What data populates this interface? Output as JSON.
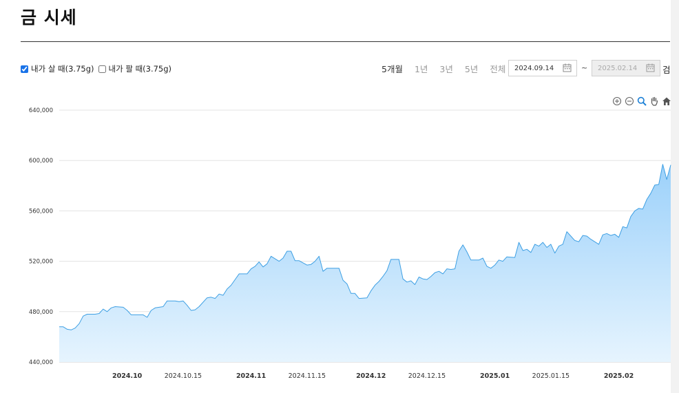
{
  "page": {
    "title": "금 시세"
  },
  "options": [
    {
      "label": "내가 살 때(3.75g)",
      "checked": true
    },
    {
      "label": "내가 팔 때(3.75g)",
      "checked": false
    }
  ],
  "periods": [
    {
      "label": "5개월",
      "active": true
    },
    {
      "label": "1년",
      "active": false
    },
    {
      "label": "3년",
      "active": false
    },
    {
      "label": "5년",
      "active": false
    },
    {
      "label": "전체",
      "active": false
    }
  ],
  "date_range": {
    "start": "2024.09.14",
    "separator": "~",
    "end": "2025.02.14",
    "search_label": "검"
  },
  "toolbar_icons": [
    "zoom-in-icon",
    "zoom-out-icon",
    "magnify-icon",
    "pan-hand-icon",
    "home-icon"
  ],
  "colors": {
    "line": "#3d9fe3",
    "fill_top": "#9cd1fa",
    "fill_bottom": "#e6f4fe",
    "grid": "#e3e3e3",
    "checkbox_accent": "#1a73e8"
  },
  "chart_data": {
    "type": "area",
    "title": "",
    "xlabel": "",
    "ylabel": "",
    "ylim": [
      440000,
      640000
    ],
    "yticks": [
      440000,
      480000,
      520000,
      560000,
      600000,
      640000
    ],
    "ytick_labels": [
      "440,000",
      "480,000",
      "520,000",
      "560,000",
      "600,000",
      "640,000"
    ],
    "xlim": [
      "2024-09-14",
      "2025-02-14"
    ],
    "xticks": [
      {
        "date": "2024-10-01",
        "label": "2024.10",
        "bold": true
      },
      {
        "date": "2024-10-15",
        "label": "2024.10.15",
        "bold": false
      },
      {
        "date": "2024-11-01",
        "label": "2024.11",
        "bold": true
      },
      {
        "date": "2024-11-15",
        "label": "2024.11.15",
        "bold": false
      },
      {
        "date": "2024-12-01",
        "label": "2024.12",
        "bold": true
      },
      {
        "date": "2024-12-15",
        "label": "2024.12.15",
        "bold": false
      },
      {
        "date": "2025-01-01",
        "label": "2025.01",
        "bold": true
      },
      {
        "date": "2025-01-15",
        "label": "2025.01.15",
        "bold": false
      },
      {
        "date": "2025-02-01",
        "label": "2025.02",
        "bold": true
      }
    ],
    "grid": true,
    "legend": "none",
    "series": [
      {
        "name": "내가 살 때(3.75g)",
        "points": [
          [
            "2024-09-14",
            468000
          ],
          [
            "2024-09-15",
            468000
          ],
          [
            "2024-09-16",
            466000
          ],
          [
            "2024-09-17",
            465500
          ],
          [
            "2024-09-18",
            467000
          ],
          [
            "2024-09-19",
            470500
          ],
          [
            "2024-09-20",
            476500
          ],
          [
            "2024-09-21",
            478000
          ],
          [
            "2024-09-23",
            478000
          ],
          [
            "2024-09-24",
            478500
          ],
          [
            "2024-09-25",
            482000
          ],
          [
            "2024-09-26",
            480000
          ],
          [
            "2024-09-27",
            483000
          ],
          [
            "2024-09-28",
            484000
          ],
          [
            "2024-09-30",
            483500
          ],
          [
            "2024-10-01",
            481000
          ],
          [
            "2024-10-02",
            477500
          ],
          [
            "2024-10-03",
            477500
          ],
          [
            "2024-10-05",
            477500
          ],
          [
            "2024-10-06",
            475500
          ],
          [
            "2024-10-07",
            481000
          ],
          [
            "2024-10-08",
            483000
          ],
          [
            "2024-10-10",
            484000
          ],
          [
            "2024-10-11",
            488500
          ],
          [
            "2024-10-13",
            488500
          ],
          [
            "2024-10-14",
            488000
          ],
          [
            "2024-10-15",
            488500
          ],
          [
            "2024-10-16",
            485000
          ],
          [
            "2024-10-17",
            481000
          ],
          [
            "2024-10-18",
            481500
          ],
          [
            "2024-10-19",
            484000
          ],
          [
            "2024-10-21",
            491000
          ],
          [
            "2024-10-22",
            491500
          ],
          [
            "2024-10-23",
            490500
          ],
          [
            "2024-10-24",
            494000
          ],
          [
            "2024-10-25",
            493000
          ],
          [
            "2024-10-26",
            498000
          ],
          [
            "2024-10-27",
            501000
          ],
          [
            "2024-10-28",
            505500
          ],
          [
            "2024-10-29",
            510000
          ],
          [
            "2024-10-31",
            510000
          ],
          [
            "2024-11-01",
            514000
          ],
          [
            "2024-11-02",
            516000
          ],
          [
            "2024-11-03",
            519500
          ],
          [
            "2024-11-04",
            515500
          ],
          [
            "2024-11-05",
            518000
          ],
          [
            "2024-11-06",
            524000
          ],
          [
            "2024-11-08",
            520000
          ],
          [
            "2024-11-09",
            522500
          ],
          [
            "2024-11-10",
            528000
          ],
          [
            "2024-11-11",
            528000
          ],
          [
            "2024-11-12",
            520500
          ],
          [
            "2024-11-13",
            520500
          ],
          [
            "2024-11-15",
            517000
          ],
          [
            "2024-11-16",
            517500
          ],
          [
            "2024-11-17",
            520000
          ],
          [
            "2024-11-18",
            524000
          ],
          [
            "2024-11-19",
            512000
          ],
          [
            "2024-11-20",
            514500
          ],
          [
            "2024-11-23",
            514500
          ],
          [
            "2024-11-24",
            505000
          ],
          [
            "2024-11-25",
            502000
          ],
          [
            "2024-11-26",
            494500
          ],
          [
            "2024-11-27",
            494500
          ],
          [
            "2024-11-28",
            490500
          ],
          [
            "2024-11-30",
            491000
          ],
          [
            "2024-12-01",
            496500
          ],
          [
            "2024-12-02",
            501000
          ],
          [
            "2024-12-03",
            504000
          ],
          [
            "2024-12-04",
            508000
          ],
          [
            "2024-12-05",
            512500
          ],
          [
            "2024-12-06",
            521500
          ],
          [
            "2024-12-08",
            521500
          ],
          [
            "2024-12-09",
            506000
          ],
          [
            "2024-12-10",
            503500
          ],
          [
            "2024-12-11",
            504500
          ],
          [
            "2024-12-12",
            501500
          ],
          [
            "2024-12-13",
            507500
          ],
          [
            "2024-12-14",
            506000
          ],
          [
            "2024-12-15",
            505500
          ],
          [
            "2024-12-16",
            508000
          ],
          [
            "2024-12-17",
            511000
          ],
          [
            "2024-12-18",
            512000
          ],
          [
            "2024-12-19",
            510000
          ],
          [
            "2024-12-20",
            514000
          ],
          [
            "2024-12-21",
            513500
          ],
          [
            "2024-12-22",
            514000
          ],
          [
            "2024-12-23",
            528000
          ],
          [
            "2024-12-24",
            533000
          ],
          [
            "2024-12-25",
            527500
          ],
          [
            "2024-12-26",
            521000
          ],
          [
            "2024-12-28",
            521000
          ],
          [
            "2024-12-29",
            522500
          ],
          [
            "2024-12-30",
            516000
          ],
          [
            "2024-12-31",
            514500
          ],
          [
            "2025-01-01",
            517000
          ],
          [
            "2025-01-02",
            521000
          ],
          [
            "2025-01-03",
            520000
          ],
          [
            "2025-01-04",
            523500
          ],
          [
            "2025-01-06",
            523000
          ],
          [
            "2025-01-07",
            535000
          ],
          [
            "2025-01-08",
            528500
          ],
          [
            "2025-01-09",
            529500
          ],
          [
            "2025-01-10",
            527000
          ],
          [
            "2025-01-11",
            533500
          ],
          [
            "2025-01-12",
            532000
          ],
          [
            "2025-01-13",
            535000
          ],
          [
            "2025-01-14",
            531000
          ],
          [
            "2025-01-15",
            533500
          ],
          [
            "2025-01-16",
            526500
          ],
          [
            "2025-01-17",
            532000
          ],
          [
            "2025-01-18",
            533500
          ],
          [
            "2025-01-19",
            543500
          ],
          [
            "2025-01-20",
            540000
          ],
          [
            "2025-01-21",
            536500
          ],
          [
            "2025-01-22",
            535500
          ],
          [
            "2025-01-23",
            540500
          ],
          [
            "2025-01-24",
            540000
          ],
          [
            "2025-01-25",
            537500
          ],
          [
            "2025-01-27",
            533500
          ],
          [
            "2025-01-28",
            541000
          ],
          [
            "2025-01-29",
            542000
          ],
          [
            "2025-01-30",
            540500
          ],
          [
            "2025-01-31",
            541500
          ],
          [
            "2025-02-01",
            539000
          ],
          [
            "2025-02-02",
            547500
          ],
          [
            "2025-02-03",
            546500
          ],
          [
            "2025-02-04",
            555500
          ],
          [
            "2025-02-05",
            560000
          ],
          [
            "2025-02-06",
            562000
          ],
          [
            "2025-02-07",
            561500
          ],
          [
            "2025-02-08",
            569000
          ],
          [
            "2025-02-09",
            574000
          ],
          [
            "2025-02-10",
            580500
          ],
          [
            "2025-02-11",
            581000
          ],
          [
            "2025-02-12",
            597000
          ],
          [
            "2025-02-13",
            585000
          ],
          [
            "2025-02-14",
            596500
          ]
        ]
      }
    ]
  }
}
